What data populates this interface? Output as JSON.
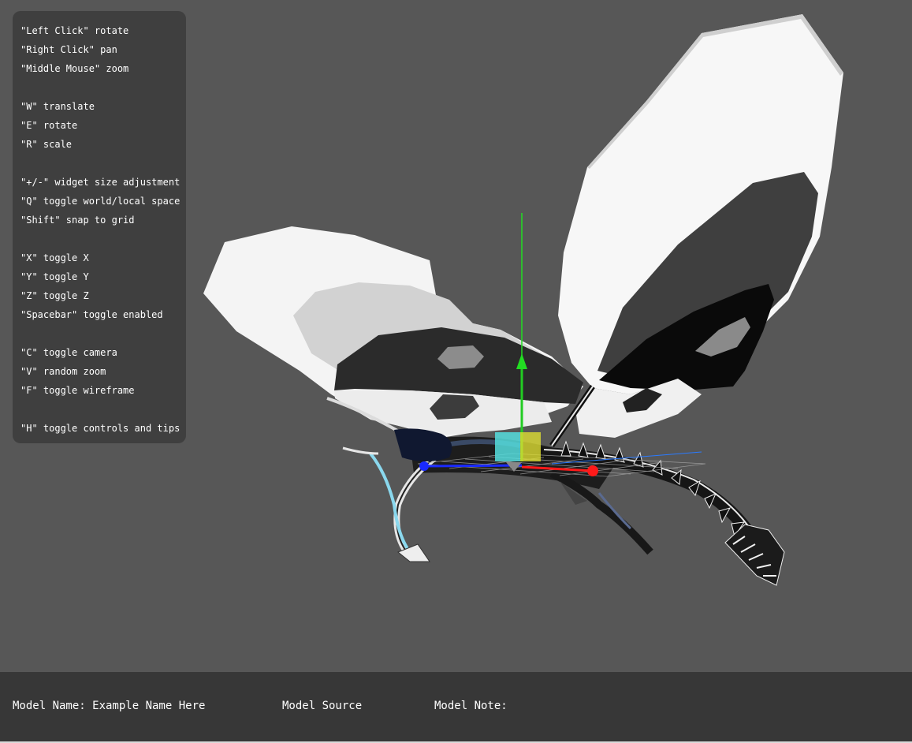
{
  "viewer": {
    "background_color": "#575757",
    "model_description": "3D butterfly/insect model with transform gizmo",
    "gizmo_axis_colors": {
      "x": "#ff1a1a",
      "y": "#22dd22",
      "z": "#1a2aff"
    }
  },
  "controls": {
    "mouse": [
      {
        "text": "\"Left Click\" rotate"
      },
      {
        "text": "\"Right Click\" pan"
      },
      {
        "text": "\"Middle Mouse\" zoom"
      }
    ],
    "transform": [
      {
        "text": "\"W\" translate"
      },
      {
        "text": "\"E\" rotate"
      },
      {
        "text": "\"R\" scale"
      }
    ],
    "gizmo": [
      {
        "text": "\"+/-\" widget size adjustment"
      },
      {
        "text": "\"Q\" toggle world/local space"
      },
      {
        "text": "\"Shift\" snap to grid"
      }
    ],
    "axes": [
      {
        "text": "\"X\" toggle X"
      },
      {
        "text": "\"Y\" toggle Y"
      },
      {
        "text": "\"Z\" toggle Z"
      },
      {
        "text": "\"Spacebar\" toggle enabled"
      }
    ],
    "view": [
      {
        "text": "\"C\" toggle camera"
      },
      {
        "text": "\"V\" random zoom"
      },
      {
        "text": "\"F\" toggle wireframe"
      }
    ],
    "help": [
      {
        "text": "\"H\" toggle controls and tips"
      }
    ]
  },
  "info_bar": {
    "model_name": "Model Name: Example Name Here",
    "model_source": "Model Source",
    "model_note": "Model Note:"
  }
}
